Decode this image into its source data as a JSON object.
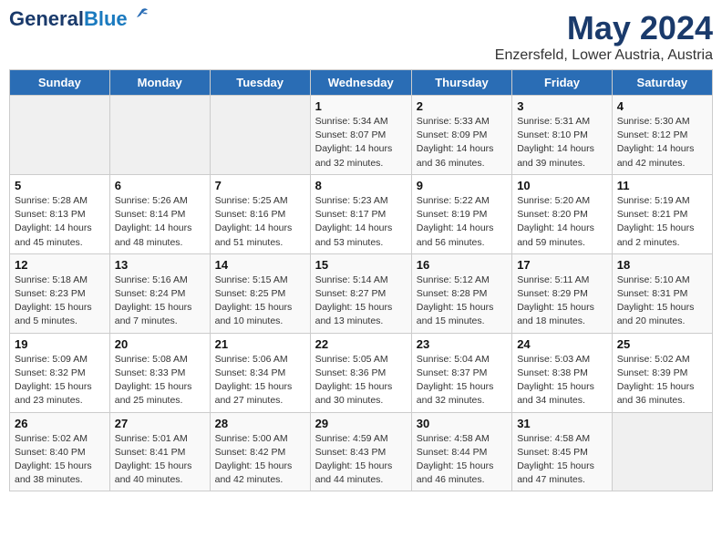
{
  "header": {
    "logo_line1": "General",
    "logo_line2": "Blue",
    "month": "May 2024",
    "location": "Enzersfeld, Lower Austria, Austria"
  },
  "days_of_week": [
    "Sunday",
    "Monday",
    "Tuesday",
    "Wednesday",
    "Thursday",
    "Friday",
    "Saturday"
  ],
  "weeks": [
    [
      {
        "num": "",
        "info": ""
      },
      {
        "num": "",
        "info": ""
      },
      {
        "num": "",
        "info": ""
      },
      {
        "num": "1",
        "info": "Sunrise: 5:34 AM\nSunset: 8:07 PM\nDaylight: 14 hours\nand 32 minutes."
      },
      {
        "num": "2",
        "info": "Sunrise: 5:33 AM\nSunset: 8:09 PM\nDaylight: 14 hours\nand 36 minutes."
      },
      {
        "num": "3",
        "info": "Sunrise: 5:31 AM\nSunset: 8:10 PM\nDaylight: 14 hours\nand 39 minutes."
      },
      {
        "num": "4",
        "info": "Sunrise: 5:30 AM\nSunset: 8:12 PM\nDaylight: 14 hours\nand 42 minutes."
      }
    ],
    [
      {
        "num": "5",
        "info": "Sunrise: 5:28 AM\nSunset: 8:13 PM\nDaylight: 14 hours\nand 45 minutes."
      },
      {
        "num": "6",
        "info": "Sunrise: 5:26 AM\nSunset: 8:14 PM\nDaylight: 14 hours\nand 48 minutes."
      },
      {
        "num": "7",
        "info": "Sunrise: 5:25 AM\nSunset: 8:16 PM\nDaylight: 14 hours\nand 51 minutes."
      },
      {
        "num": "8",
        "info": "Sunrise: 5:23 AM\nSunset: 8:17 PM\nDaylight: 14 hours\nand 53 minutes."
      },
      {
        "num": "9",
        "info": "Sunrise: 5:22 AM\nSunset: 8:19 PM\nDaylight: 14 hours\nand 56 minutes."
      },
      {
        "num": "10",
        "info": "Sunrise: 5:20 AM\nSunset: 8:20 PM\nDaylight: 14 hours\nand 59 minutes."
      },
      {
        "num": "11",
        "info": "Sunrise: 5:19 AM\nSunset: 8:21 PM\nDaylight: 15 hours\nand 2 minutes."
      }
    ],
    [
      {
        "num": "12",
        "info": "Sunrise: 5:18 AM\nSunset: 8:23 PM\nDaylight: 15 hours\nand 5 minutes."
      },
      {
        "num": "13",
        "info": "Sunrise: 5:16 AM\nSunset: 8:24 PM\nDaylight: 15 hours\nand 7 minutes."
      },
      {
        "num": "14",
        "info": "Sunrise: 5:15 AM\nSunset: 8:25 PM\nDaylight: 15 hours\nand 10 minutes."
      },
      {
        "num": "15",
        "info": "Sunrise: 5:14 AM\nSunset: 8:27 PM\nDaylight: 15 hours\nand 13 minutes."
      },
      {
        "num": "16",
        "info": "Sunrise: 5:12 AM\nSunset: 8:28 PM\nDaylight: 15 hours\nand 15 minutes."
      },
      {
        "num": "17",
        "info": "Sunrise: 5:11 AM\nSunset: 8:29 PM\nDaylight: 15 hours\nand 18 minutes."
      },
      {
        "num": "18",
        "info": "Sunrise: 5:10 AM\nSunset: 8:31 PM\nDaylight: 15 hours\nand 20 minutes."
      }
    ],
    [
      {
        "num": "19",
        "info": "Sunrise: 5:09 AM\nSunset: 8:32 PM\nDaylight: 15 hours\nand 23 minutes."
      },
      {
        "num": "20",
        "info": "Sunrise: 5:08 AM\nSunset: 8:33 PM\nDaylight: 15 hours\nand 25 minutes."
      },
      {
        "num": "21",
        "info": "Sunrise: 5:06 AM\nSunset: 8:34 PM\nDaylight: 15 hours\nand 27 minutes."
      },
      {
        "num": "22",
        "info": "Sunrise: 5:05 AM\nSunset: 8:36 PM\nDaylight: 15 hours\nand 30 minutes."
      },
      {
        "num": "23",
        "info": "Sunrise: 5:04 AM\nSunset: 8:37 PM\nDaylight: 15 hours\nand 32 minutes."
      },
      {
        "num": "24",
        "info": "Sunrise: 5:03 AM\nSunset: 8:38 PM\nDaylight: 15 hours\nand 34 minutes."
      },
      {
        "num": "25",
        "info": "Sunrise: 5:02 AM\nSunset: 8:39 PM\nDaylight: 15 hours\nand 36 minutes."
      }
    ],
    [
      {
        "num": "26",
        "info": "Sunrise: 5:02 AM\nSunset: 8:40 PM\nDaylight: 15 hours\nand 38 minutes."
      },
      {
        "num": "27",
        "info": "Sunrise: 5:01 AM\nSunset: 8:41 PM\nDaylight: 15 hours\nand 40 minutes."
      },
      {
        "num": "28",
        "info": "Sunrise: 5:00 AM\nSunset: 8:42 PM\nDaylight: 15 hours\nand 42 minutes."
      },
      {
        "num": "29",
        "info": "Sunrise: 4:59 AM\nSunset: 8:43 PM\nDaylight: 15 hours\nand 44 minutes."
      },
      {
        "num": "30",
        "info": "Sunrise: 4:58 AM\nSunset: 8:44 PM\nDaylight: 15 hours\nand 46 minutes."
      },
      {
        "num": "31",
        "info": "Sunrise: 4:58 AM\nSunset: 8:45 PM\nDaylight: 15 hours\nand 47 minutes."
      },
      {
        "num": "",
        "info": ""
      }
    ]
  ]
}
